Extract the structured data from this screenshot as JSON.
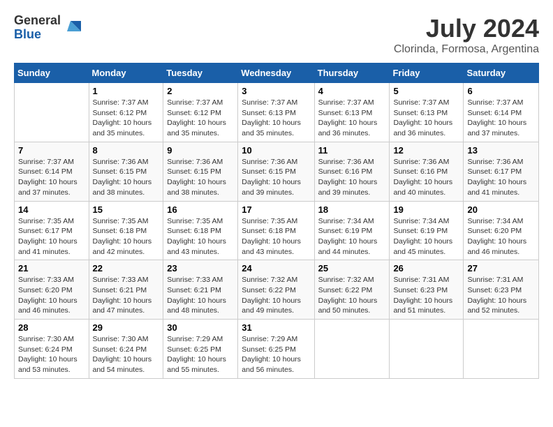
{
  "logo": {
    "general": "General",
    "blue": "Blue"
  },
  "title": "July 2024",
  "location": "Clorinda, Formosa, Argentina",
  "headers": [
    "Sunday",
    "Monday",
    "Tuesday",
    "Wednesday",
    "Thursday",
    "Friday",
    "Saturday"
  ],
  "weeks": [
    [
      {
        "day": "",
        "info": ""
      },
      {
        "day": "1",
        "info": "Sunrise: 7:37 AM\nSunset: 6:12 PM\nDaylight: 10 hours\nand 35 minutes."
      },
      {
        "day": "2",
        "info": "Sunrise: 7:37 AM\nSunset: 6:12 PM\nDaylight: 10 hours\nand 35 minutes."
      },
      {
        "day": "3",
        "info": "Sunrise: 7:37 AM\nSunset: 6:13 PM\nDaylight: 10 hours\nand 35 minutes."
      },
      {
        "day": "4",
        "info": "Sunrise: 7:37 AM\nSunset: 6:13 PM\nDaylight: 10 hours\nand 36 minutes."
      },
      {
        "day": "5",
        "info": "Sunrise: 7:37 AM\nSunset: 6:13 PM\nDaylight: 10 hours\nand 36 minutes."
      },
      {
        "day": "6",
        "info": "Sunrise: 7:37 AM\nSunset: 6:14 PM\nDaylight: 10 hours\nand 37 minutes."
      }
    ],
    [
      {
        "day": "7",
        "info": "Sunrise: 7:37 AM\nSunset: 6:14 PM\nDaylight: 10 hours\nand 37 minutes."
      },
      {
        "day": "8",
        "info": "Sunrise: 7:36 AM\nSunset: 6:15 PM\nDaylight: 10 hours\nand 38 minutes."
      },
      {
        "day": "9",
        "info": "Sunrise: 7:36 AM\nSunset: 6:15 PM\nDaylight: 10 hours\nand 38 minutes."
      },
      {
        "day": "10",
        "info": "Sunrise: 7:36 AM\nSunset: 6:15 PM\nDaylight: 10 hours\nand 39 minutes."
      },
      {
        "day": "11",
        "info": "Sunrise: 7:36 AM\nSunset: 6:16 PM\nDaylight: 10 hours\nand 39 minutes."
      },
      {
        "day": "12",
        "info": "Sunrise: 7:36 AM\nSunset: 6:16 PM\nDaylight: 10 hours\nand 40 minutes."
      },
      {
        "day": "13",
        "info": "Sunrise: 7:36 AM\nSunset: 6:17 PM\nDaylight: 10 hours\nand 41 minutes."
      }
    ],
    [
      {
        "day": "14",
        "info": "Sunrise: 7:35 AM\nSunset: 6:17 PM\nDaylight: 10 hours\nand 41 minutes."
      },
      {
        "day": "15",
        "info": "Sunrise: 7:35 AM\nSunset: 6:18 PM\nDaylight: 10 hours\nand 42 minutes."
      },
      {
        "day": "16",
        "info": "Sunrise: 7:35 AM\nSunset: 6:18 PM\nDaylight: 10 hours\nand 43 minutes."
      },
      {
        "day": "17",
        "info": "Sunrise: 7:35 AM\nSunset: 6:18 PM\nDaylight: 10 hours\nand 43 minutes."
      },
      {
        "day": "18",
        "info": "Sunrise: 7:34 AM\nSunset: 6:19 PM\nDaylight: 10 hours\nand 44 minutes."
      },
      {
        "day": "19",
        "info": "Sunrise: 7:34 AM\nSunset: 6:19 PM\nDaylight: 10 hours\nand 45 minutes."
      },
      {
        "day": "20",
        "info": "Sunrise: 7:34 AM\nSunset: 6:20 PM\nDaylight: 10 hours\nand 46 minutes."
      }
    ],
    [
      {
        "day": "21",
        "info": "Sunrise: 7:33 AM\nSunset: 6:20 PM\nDaylight: 10 hours\nand 46 minutes."
      },
      {
        "day": "22",
        "info": "Sunrise: 7:33 AM\nSunset: 6:21 PM\nDaylight: 10 hours\nand 47 minutes."
      },
      {
        "day": "23",
        "info": "Sunrise: 7:33 AM\nSunset: 6:21 PM\nDaylight: 10 hours\nand 48 minutes."
      },
      {
        "day": "24",
        "info": "Sunrise: 7:32 AM\nSunset: 6:22 PM\nDaylight: 10 hours\nand 49 minutes."
      },
      {
        "day": "25",
        "info": "Sunrise: 7:32 AM\nSunset: 6:22 PM\nDaylight: 10 hours\nand 50 minutes."
      },
      {
        "day": "26",
        "info": "Sunrise: 7:31 AM\nSunset: 6:23 PM\nDaylight: 10 hours\nand 51 minutes."
      },
      {
        "day": "27",
        "info": "Sunrise: 7:31 AM\nSunset: 6:23 PM\nDaylight: 10 hours\nand 52 minutes."
      }
    ],
    [
      {
        "day": "28",
        "info": "Sunrise: 7:30 AM\nSunset: 6:24 PM\nDaylight: 10 hours\nand 53 minutes."
      },
      {
        "day": "29",
        "info": "Sunrise: 7:30 AM\nSunset: 6:24 PM\nDaylight: 10 hours\nand 54 minutes."
      },
      {
        "day": "30",
        "info": "Sunrise: 7:29 AM\nSunset: 6:25 PM\nDaylight: 10 hours\nand 55 minutes."
      },
      {
        "day": "31",
        "info": "Sunrise: 7:29 AM\nSunset: 6:25 PM\nDaylight: 10 hours\nand 56 minutes."
      },
      {
        "day": "",
        "info": ""
      },
      {
        "day": "",
        "info": ""
      },
      {
        "day": "",
        "info": ""
      }
    ]
  ]
}
